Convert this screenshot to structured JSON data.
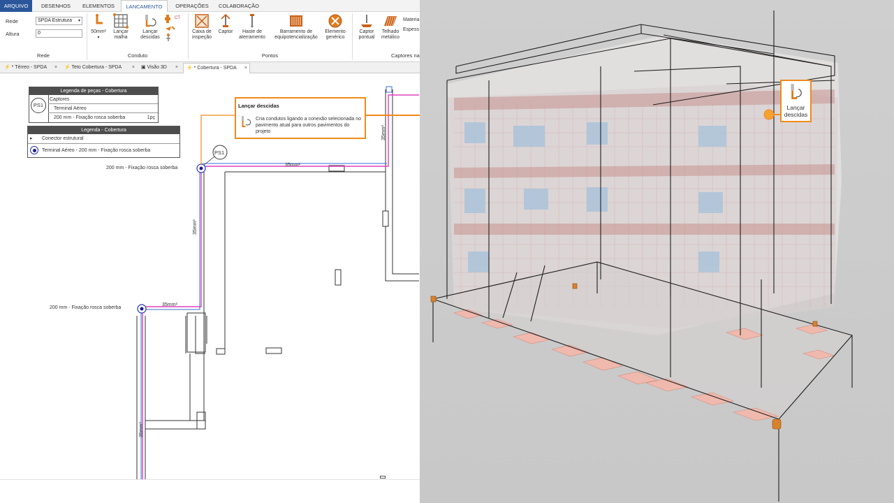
{
  "menu": {
    "tabs": [
      "ARQUIVO",
      "DESENHOS",
      "ELEMENTOS",
      "LANCAMENTO",
      "OPERAÇÕES",
      "COLABORAÇÃO"
    ],
    "active": "LANCAMENTO"
  },
  "ribbon": {
    "rede_label": "Rede",
    "rede_value": "SPDA Estrutura",
    "altura_label": "Altura",
    "altura_value": "0",
    "group_rede": "Rede",
    "group_conduto": "Conduto",
    "group_pontos": "Pontos",
    "group_captores": "Captores na",
    "btn_50mm": "50mm²",
    "btn_malha": "Lançar malha",
    "btn_descidas": "Lançar descidas",
    "btn_caixa": "Caixa de inspeção",
    "btn_captor": "Captor",
    "btn_haste": "Haste de aterramento",
    "btn_barramento": "Barramento de equipotencialização",
    "btn_elemento": "Elemento genérico",
    "btn_captor_pontual": "Captor pontual",
    "btn_telhado": "Telhado metálico",
    "materia": "Materia",
    "espessura": "Espess"
  },
  "doc_tabs": [
    {
      "label": "* Térreo - SPDA"
    },
    {
      "label": "Teto Cobertura - SPDA"
    },
    {
      "label": "Visão 3D"
    },
    {
      "label": "* Cobertura - SPDA",
      "active": true
    }
  ],
  "legend_pecas": {
    "title": "Legenda de peças - Cobertura",
    "symbol": "PS1",
    "row1": "Captores",
    "row2": "Terminal Aéreo",
    "row3": "200 mm - Fixação rosca soberba",
    "qty": "1pç"
  },
  "legend_cobertura": {
    "title": "Legenda - Cobertura",
    "row1": "Conector estrutural",
    "row2": "Terminal Aéreo - 200 mm - Fixação rosca soberba"
  },
  "drawing": {
    "ps1_tag": "PS1",
    "label_top": "200 mm - Fixação rosca soberba",
    "label_bottom": "200 mm - Fixação rosca soberba",
    "conductor_h1": "35mm²",
    "conductor_h2": "35mm²",
    "conductor_v1": "35mm²",
    "conductor_v2": "35mm²",
    "conductor_v3": "35mm²"
  },
  "tooltip": {
    "title": "Lançar descidas",
    "body": "Cria condutos ligando a conexão selecionada no pavimento atual para outros pavimentos do projeto"
  },
  "callout": {
    "label": "Lançar descidas"
  },
  "colors": {
    "accent": "#f08a1a",
    "menu_blue": "#2b579a",
    "conductor_pink": "#e040c0",
    "conductor_blue": "#3a6cd6"
  }
}
